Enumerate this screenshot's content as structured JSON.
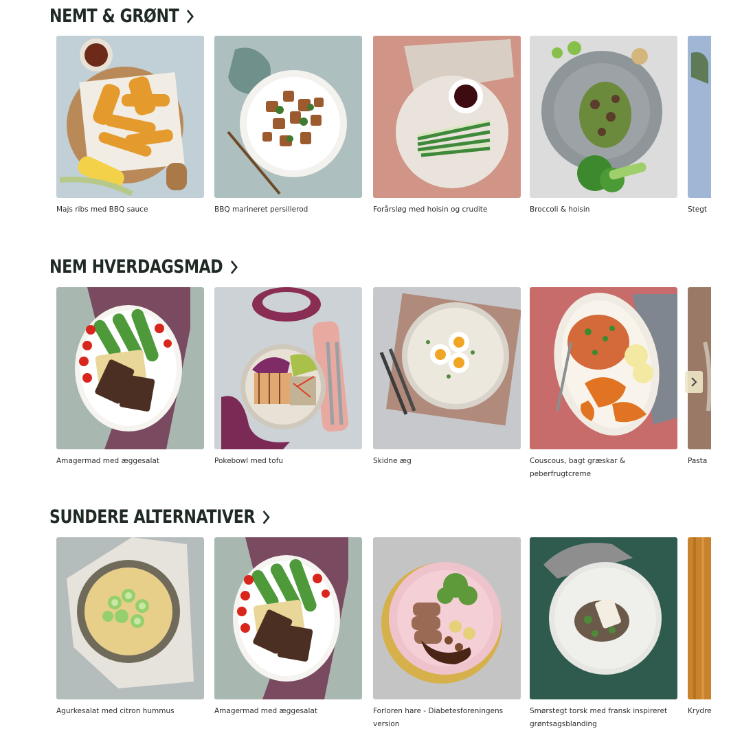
{
  "sections": [
    {
      "title": "NEMT & GRØNT",
      "cards": [
        {
          "title": "Majs ribs med BBQ sauce"
        },
        {
          "title": "BBQ marineret persillerod"
        },
        {
          "title": "Forårsløg med hoisin og crudite"
        },
        {
          "title": "Broccoli & hoisin"
        },
        {
          "title": "Stegt"
        }
      ]
    },
    {
      "title": "NEM HVERDAGSMAD",
      "cards": [
        {
          "title": "Amagermad med æggesalat"
        },
        {
          "title": "Pokebowl med tofu"
        },
        {
          "title": "Skidne æg"
        },
        {
          "title": "Couscous, bagt græskar & peberfrugtcreme"
        },
        {
          "title": "Pasta"
        }
      ]
    },
    {
      "title": "SUNDERE ALTERNATIVER",
      "cards": [
        {
          "title": "Agurkesalat med citron hummus"
        },
        {
          "title": "Amagermad med æggesalat"
        },
        {
          "title": "Forloren hare - Diabetesforeningens version"
        },
        {
          "title": "Smørstegt torsk med fransk inspireret grøntsagsblanding"
        },
        {
          "title": "Krydre"
        }
      ]
    }
  ],
  "icons": {
    "heading_arrow": "chevron-right-icon",
    "carousel_next": "chevron-right-icon"
  }
}
